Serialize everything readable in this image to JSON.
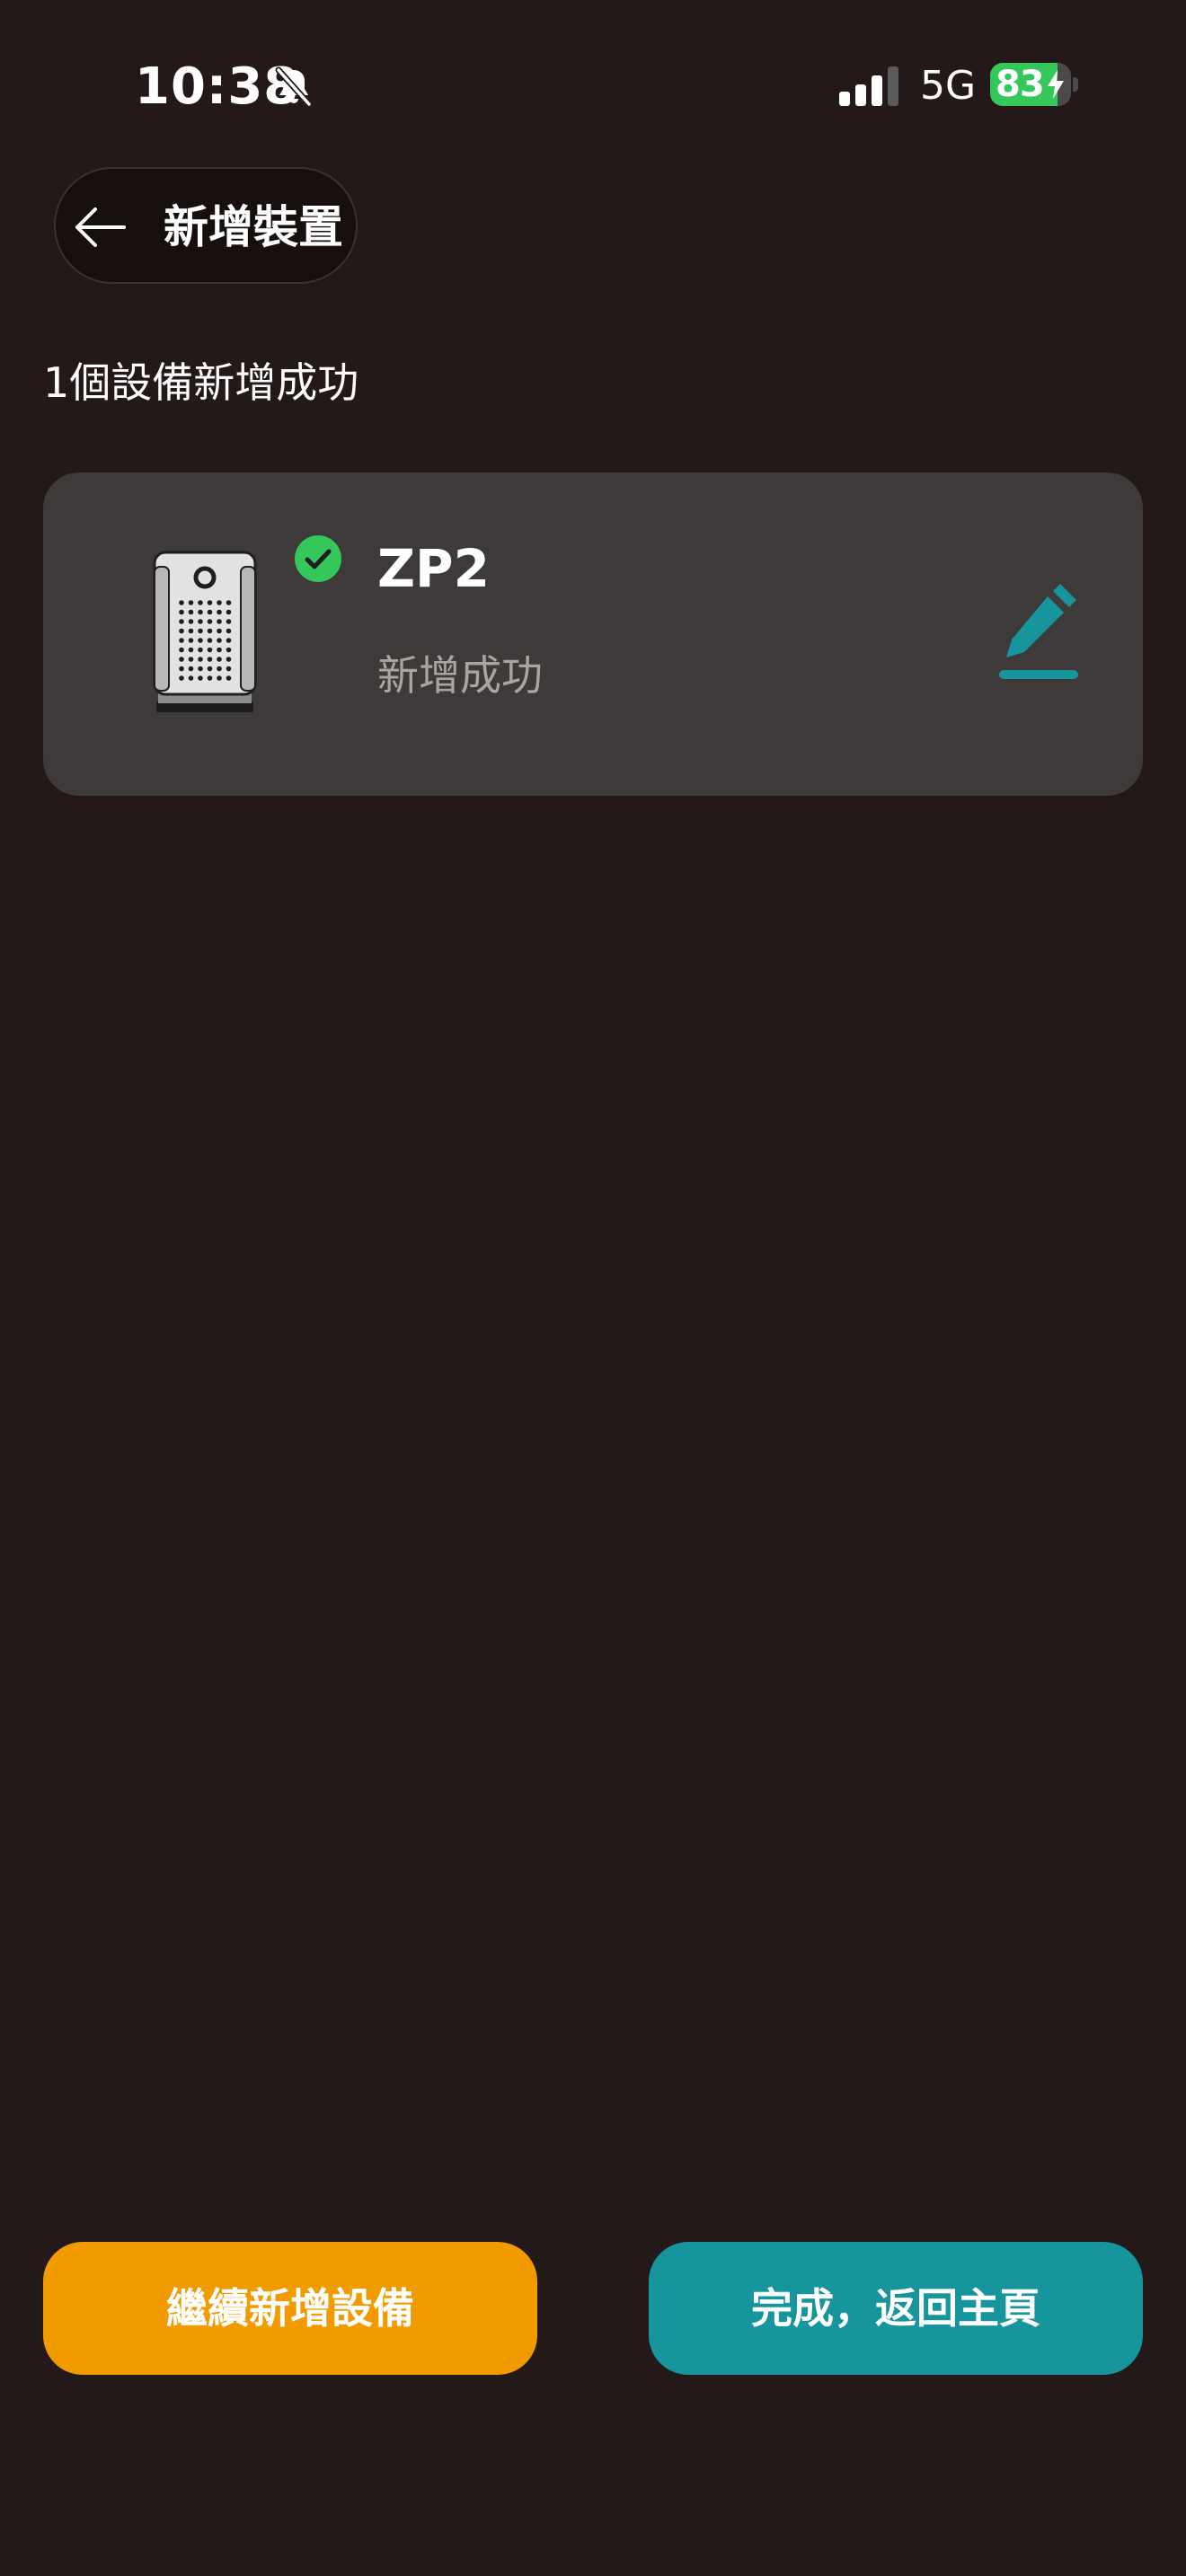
{
  "status_bar": {
    "time": "10:38",
    "network": "5G",
    "battery_percent": "83",
    "battery_level": 0.83,
    "silent_mode_icon": "bell-slash-icon"
  },
  "header": {
    "back_icon": "back-arrow-icon",
    "title": "新增裝置"
  },
  "summary": "1個設備新增成功",
  "device": {
    "name": "ZP2",
    "status": "新增成功",
    "status_icon": "check-circle-icon",
    "action_icon": "edit-icon"
  },
  "buttons": {
    "continue_label": "繼續新增設備",
    "done_label": "完成，返回主頁"
  },
  "colors": {
    "background": "#221918",
    "card": "#3d3a39",
    "success_green": "#34c759",
    "accent_teal": "#17959c",
    "accent_orange": "#f19b00",
    "secondary_text": "#a9a5a3"
  }
}
